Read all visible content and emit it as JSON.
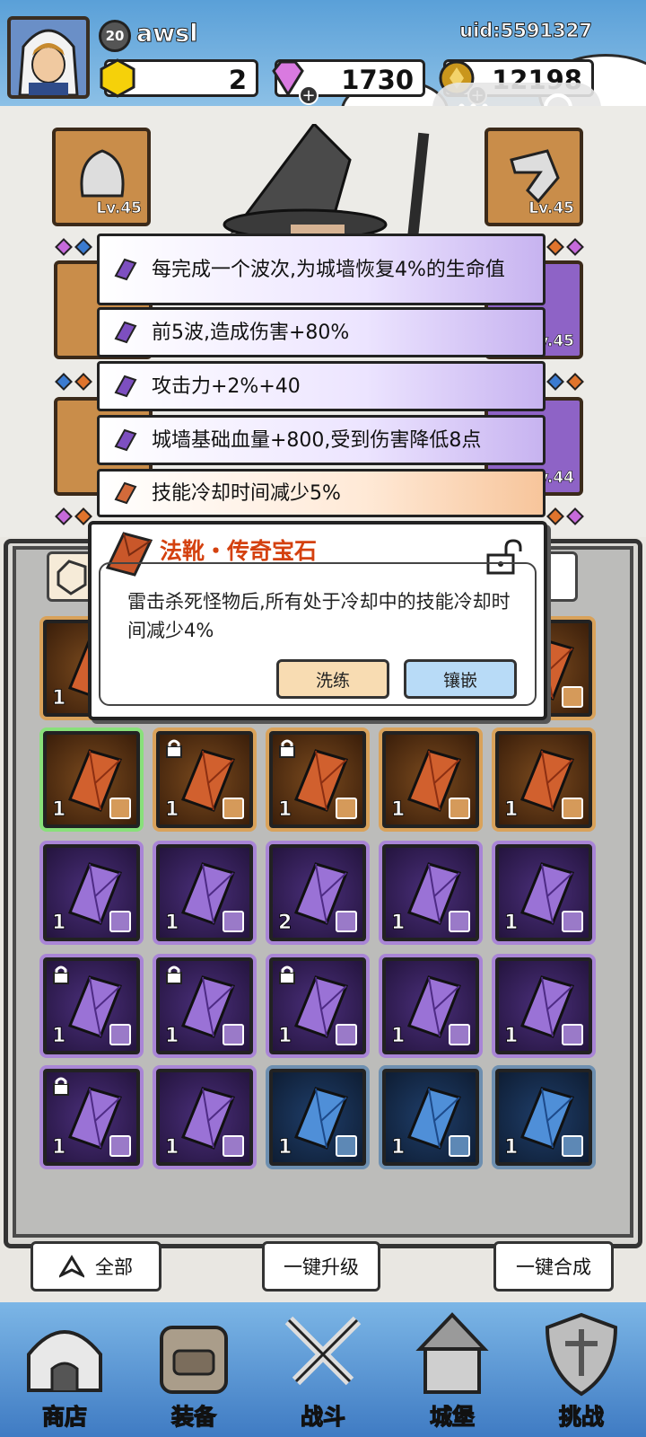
{
  "player": {
    "level": "20",
    "name": "awsl",
    "uid": "uid:5591327"
  },
  "currency": {
    "gold_gem": "2",
    "diamond": "1730",
    "coin": "12198"
  },
  "hero_slots": {
    "top_left_level": "Lv.45",
    "top_right_level": "Lv.45",
    "right2_level": "v.45",
    "right3_level": "v.44"
  },
  "affixes": [
    {
      "text": "每完成一个波次,为城墙恢复4%的生命值",
      "quality": "epic"
    },
    {
      "text": "前5波,造成伤害+80%",
      "quality": "epic"
    },
    {
      "text": "攻击力+2%+40",
      "quality": "epic"
    },
    {
      "text": "城墙基础血量+800,受到伤害降低8点",
      "quality": "epic"
    },
    {
      "text": "技能冷却时间减少5%",
      "quality": "legend"
    }
  ],
  "popup": {
    "title": "法靴・传奇宝石",
    "description": "雷击杀死怪物后,所有处于冷却中的技能冷却时间减少4%",
    "reroll_label": "洗练",
    "inlay_label": "镶嵌"
  },
  "inventory": {
    "rows": [
      [
        {
          "q": "legend",
          "count": "1",
          "locked": false
        },
        {
          "q": "legend",
          "count": "",
          "locked": false
        },
        {
          "q": "legend",
          "count": "",
          "locked": false
        },
        {
          "q": "legend",
          "count": "",
          "locked": false
        },
        {
          "q": "legend",
          "count": "",
          "locked": false
        }
      ],
      [
        {
          "q": "legend",
          "count": "1",
          "locked": false
        },
        {
          "q": "legend",
          "count": "1",
          "locked": true
        },
        {
          "q": "legend",
          "count": "1",
          "locked": true
        },
        {
          "q": "legend",
          "count": "1",
          "locked": false
        },
        {
          "q": "legend",
          "count": "1",
          "locked": false
        }
      ],
      [
        {
          "q": "epic",
          "count": "1",
          "locked": false
        },
        {
          "q": "epic",
          "count": "1",
          "locked": false
        },
        {
          "q": "epic",
          "count": "2",
          "locked": false
        },
        {
          "q": "epic",
          "count": "1",
          "locked": false
        },
        {
          "q": "epic",
          "count": "1",
          "locked": false
        }
      ],
      [
        {
          "q": "epic",
          "count": "1",
          "locked": true
        },
        {
          "q": "epic",
          "count": "1",
          "locked": true
        },
        {
          "q": "epic",
          "count": "1",
          "locked": true
        },
        {
          "q": "epic",
          "count": "1",
          "locked": false
        },
        {
          "q": "epic",
          "count": "1",
          "locked": false
        }
      ],
      [
        {
          "q": "epic",
          "count": "1",
          "locked": true
        },
        {
          "q": "epic",
          "count": "1",
          "locked": false
        },
        {
          "q": "rare",
          "count": "1",
          "locked": false
        },
        {
          "q": "rare",
          "count": "1",
          "locked": false
        },
        {
          "q": "rare",
          "count": "1",
          "locked": false
        }
      ]
    ]
  },
  "actions": {
    "filter_all": "全部",
    "upgrade_all": "一键升级",
    "merge_all": "一键合成"
  },
  "nav": [
    {
      "label": "商店"
    },
    {
      "label": "装备"
    },
    {
      "label": "战斗"
    },
    {
      "label": "城堡"
    },
    {
      "label": "挑战"
    }
  ],
  "colors": {
    "legend": "#d36a3a",
    "epic": "#8e63c6",
    "rare": "#3e78c4",
    "title": "#d4410f"
  }
}
